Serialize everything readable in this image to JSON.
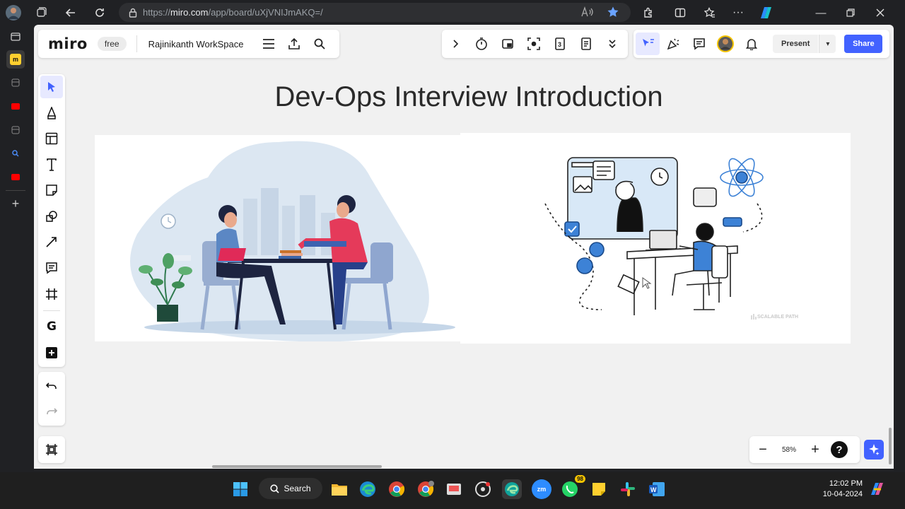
{
  "browser": {
    "url_prefix": "https://",
    "url_domain": "miro.com",
    "url_path": "/app/board/uXjVNIJmAKQ=/"
  },
  "miro": {
    "logo": "miro",
    "plan_badge": "free",
    "board_name": "Rajinikanth WorkSpace",
    "present_label": "Present",
    "share_label": "Share",
    "zoom_level": "58%",
    "board_title": "Dev-Ops Interview Introduction",
    "watermark": "SCALABLE PATH"
  },
  "taskbar": {
    "search_label": "Search",
    "whatsapp_badge": "98",
    "time": "12:02 PM",
    "date": "10-04-2024"
  },
  "colors": {
    "accent": "#4262ff",
    "canvas": "#f1f1f1",
    "chrome": "#202124"
  }
}
